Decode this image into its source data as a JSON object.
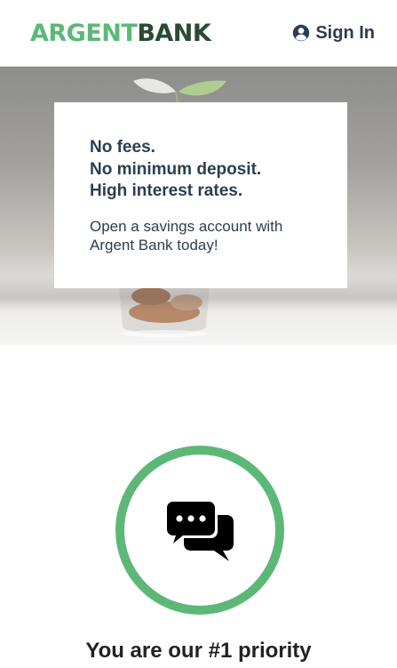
{
  "nav": {
    "logo_part1": "ARGENT",
    "logo_part2": "BANK",
    "signin_label": "Sign In",
    "signin_icon": "user-circle-icon"
  },
  "hero": {
    "subtitle_lines": [
      "No fees.",
      "No minimum deposit.",
      "High interest rates."
    ],
    "text_line1": "Open a savings account with",
    "text_line2": "Argent Bank today!"
  },
  "features": [
    {
      "icon": "chat-icon",
      "title": "You are our #1 priority"
    }
  ],
  "colors": {
    "brand_green": "#5db878",
    "brand_dark": "#2a4a35",
    "text": "#2c3e50"
  }
}
